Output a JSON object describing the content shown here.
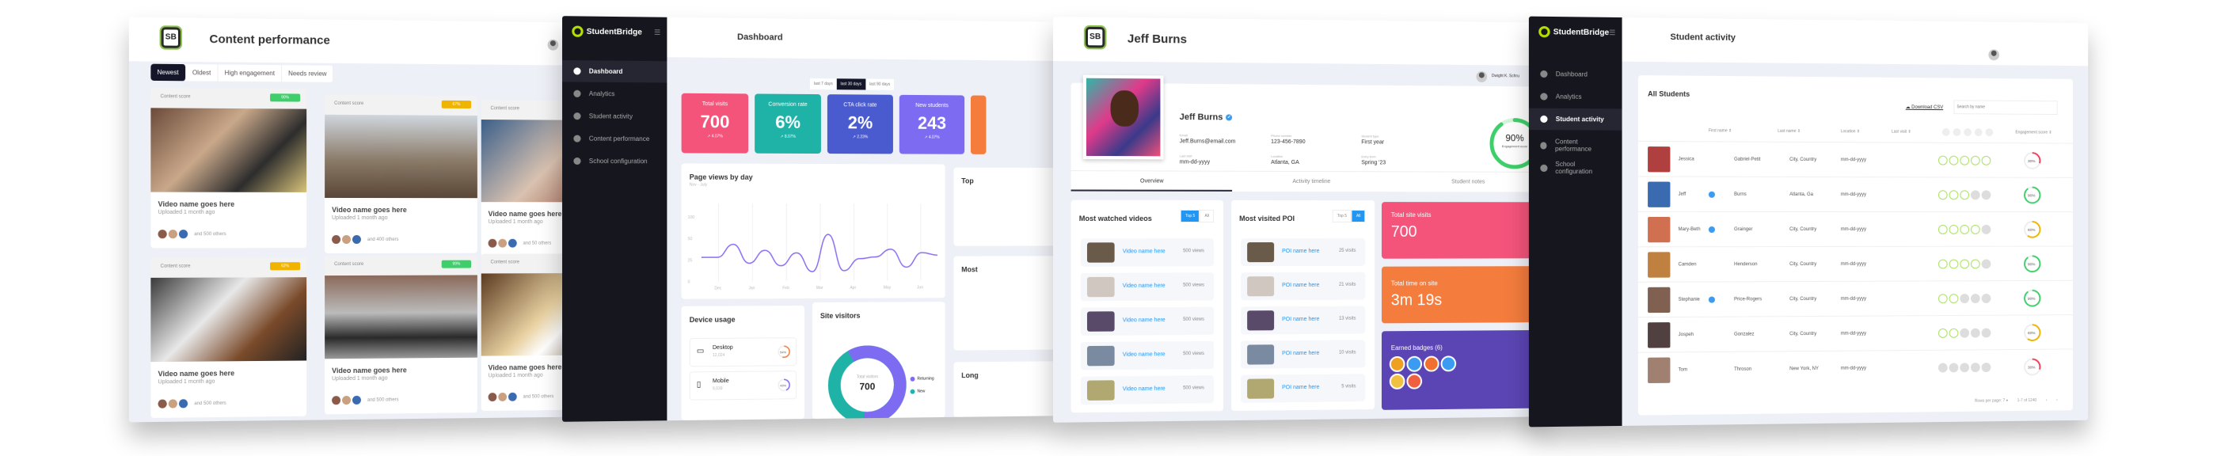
{
  "content_performance": {
    "title": "Content performance",
    "logo_text": "SB",
    "filters": [
      "Newest",
      "Oldest",
      "High engagement",
      "Needs review"
    ],
    "active_filter": "Newest",
    "cards": [
      {
        "score_label": "Content score",
        "score": "90%",
        "score_color": "#3ecf6a",
        "video_name": "Video name goes here",
        "uploaded": "Uploaded 1 month ago",
        "others": "and 500 others",
        "img": "linear-gradient(135deg,#6b4a3a,#c9a88a 40%,#2d2d2d 70%,#d8c37a)"
      },
      {
        "score_label": "Content score",
        "score": "67%",
        "score_color": "#f0b400",
        "video_name": "Video name goes here",
        "uploaded": "Uploaded 1 month ago",
        "others": "and 400 others",
        "img": "linear-gradient(180deg,#cfd6de,#8a7a68 55%,#5a4636)"
      },
      {
        "score_label": "Content score",
        "score": "",
        "score_color": "",
        "video_name": "Video name goes here",
        "uploaded": "Uploaded 1 month ago",
        "others": "and 50 others",
        "img": "linear-gradient(135deg,#3b5f8a,#d9c2b0 50%,#8a3a2a)"
      },
      {
        "score_label": "Content score",
        "score": "62%",
        "score_color": "#f0b400",
        "video_name": "Video name goes here",
        "uploaded": "Uploaded 1 month ago",
        "others": "and 500 others",
        "img": "linear-gradient(135deg,#3a3a3a,#e8e8e8 40%,#7a4a2a 70%,#222)"
      },
      {
        "score_label": "Content score",
        "score": "99%",
        "score_color": "#3ecf6a",
        "video_name": "Video name goes here",
        "uploaded": "Uploaded 1 month ago",
        "others": "and 500 others",
        "img": "linear-gradient(180deg,#8a6a5a,#bbb 45%,#2a2a2a 75%,#999)"
      },
      {
        "score_label": "Content score",
        "score": "",
        "score_color": "",
        "video_name": "Video name goes here",
        "uploaded": "Uploaded 1 month ago",
        "others": "and 500 others",
        "img": "linear-gradient(135deg,#5a3a20,#e8d0a0 45%,#fff 60%,#6a4a2a)"
      }
    ]
  },
  "dashboard": {
    "brand": "StudentBridge",
    "title": "Dashboard",
    "nav": [
      "Dashboard",
      "Analytics",
      "Student activity",
      "Content performance",
      "School configuration"
    ],
    "active_nav": "Dashboard",
    "ranges": [
      "last 7 days",
      "last 30 days",
      "last 90 days"
    ],
    "active_range": "last 30 days",
    "kpis": [
      {
        "label": "Total visits",
        "value": "700",
        "delta": "4.07%",
        "color": "#f4537a"
      },
      {
        "label": "Conversion rate",
        "value": "6%",
        "delta": "8.07%",
        "color": "#1fb3a8"
      },
      {
        "label": "CTA click rate",
        "value": "2%",
        "delta": "2.23%",
        "color": "#4a5bd0"
      },
      {
        "label": "New students",
        "value": "243",
        "delta": "4.07%",
        "color": "#7d6cf2"
      }
    ],
    "kpi_extra_color": "#f47c3c",
    "device_usage": {
      "title": "Device usage",
      "items": [
        {
          "label": "Desktop",
          "count": "12,024",
          "pct": "54%",
          "pct_value": 54,
          "color": "#f47c3c"
        },
        {
          "label": "Mobile",
          "count": "9,039",
          "pct": "43%",
          "pct_value": 43,
          "color": "#7d6cf2"
        }
      ]
    },
    "site_visitors": {
      "title": "Site visitors",
      "center_label": "Total visitors",
      "center_value": "700",
      "legend": [
        {
          "name": "Returning",
          "color": "#7d6cf2"
        },
        {
          "name": "New",
          "color": "#1fb3a8"
        }
      ]
    },
    "side_titles": [
      "Top",
      "Most",
      "Long"
    ]
  },
  "chart_data": {
    "type": "line",
    "title": "Page views by day",
    "subtitle": "Nov - July",
    "x_ticks": [
      "Dec",
      "Jan",
      "Feb",
      "Mar",
      "Apr",
      "May",
      "Jun"
    ],
    "y_ticks": [
      0,
      25,
      50,
      100
    ],
    "values": [
      28,
      28,
      43,
      21,
      36,
      18,
      33,
      11,
      59,
      12,
      26,
      28,
      37,
      16,
      33,
      30
    ],
    "color": "#8b6cf2",
    "grid": "vertical"
  },
  "student_profile": {
    "title": "Jeff Burns",
    "user": "Dwight K. Schru",
    "name": "Jeff Burns",
    "fields": [
      {
        "label": "Email",
        "value": "Jeff.Burns@email.com"
      },
      {
        "label": "Last visit",
        "value": "mm-dd-yyyy"
      },
      {
        "label": "Phone number",
        "value": "123-456-7890"
      },
      {
        "label": "Location",
        "value": "Atlanta, GA"
      },
      {
        "label": "Student type",
        "value": "First year"
      },
      {
        "label": "Entry term",
        "value": "Spring '23"
      }
    ],
    "engagement": {
      "value": "90%",
      "label": "Engagement score",
      "pct": 90
    },
    "tabs": [
      "Overview",
      "Activity timeline",
      "Student notes"
    ],
    "active_tab": "Overview",
    "videos": {
      "title": "Most watched videos",
      "toggle": [
        "Top 5",
        "All"
      ],
      "active": "Top 5",
      "items": [
        {
          "name": "Video name here",
          "views": "500 views"
        },
        {
          "name": "Video name here",
          "views": "500 views"
        },
        {
          "name": "Video name here",
          "views": "500 views"
        },
        {
          "name": "Video name here",
          "views": "500 views"
        },
        {
          "name": "Video name here",
          "views": "500 views"
        }
      ]
    },
    "poi": {
      "title": "Most visited POI",
      "toggle": [
        "Top 5",
        "All"
      ],
      "active": "All",
      "items": [
        {
          "name": "POI name here",
          "visits": "25 visits"
        },
        {
          "name": "POI name here",
          "visits": "21 visits"
        },
        {
          "name": "POI name here",
          "visits": "13 visits"
        },
        {
          "name": "POI name here",
          "visits": "10 visits"
        },
        {
          "name": "POI name here",
          "visits": "5 visits"
        }
      ]
    },
    "total_site_visits": {
      "label": "Total site visits",
      "value": "700"
    },
    "time_on_site": {
      "label": "Total time on site",
      "value": "3m 19s"
    },
    "badges": {
      "label": "Earned badges (6)",
      "count": 6
    }
  },
  "student_activity": {
    "brand": "StudentBridge",
    "title": "Student activity",
    "nav": [
      "Dashboard",
      "Analytics",
      "Student activity",
      "Content performance",
      "School configuration"
    ],
    "active_nav": "Student activity",
    "table_title": "All Students",
    "download": "Download CSV",
    "search_placeholder": "Search by name",
    "columns": [
      "First name",
      "Last name",
      "Location",
      "Last visit",
      "Engagement score"
    ],
    "rows": [
      {
        "first": "Jessica",
        "verified": false,
        "last": "Gabriel-Petit",
        "location": "City, Country",
        "visit": "mm-dd-yyyy",
        "badges": 5,
        "score": "30%",
        "pct": 30,
        "color": "#f0405a"
      },
      {
        "first": "Jeff",
        "verified": true,
        "last": "Burns",
        "location": "Atlanta, Ga",
        "visit": "mm-dd-yyyy",
        "badges": 3,
        "score": "90%",
        "pct": 90,
        "color": "#3ecf6a"
      },
      {
        "first": "Mary-Beth",
        "verified": true,
        "last": "Grainger",
        "location": "City, Country",
        "visit": "mm-dd-yyyy",
        "badges": 4,
        "score": "60%",
        "pct": 60,
        "color": "#f0b400"
      },
      {
        "first": "Camden",
        "verified": false,
        "last": "Henderson",
        "location": "City, Country",
        "visit": "mm-dd-yyyy",
        "badges": 4,
        "score": "90%",
        "pct": 90,
        "color": "#3ecf6a"
      },
      {
        "first": "Stephanie",
        "verified": true,
        "last": "Price-Rogers",
        "location": "City, Country",
        "visit": "mm-dd-yyyy",
        "badges": 2,
        "score": "90%",
        "pct": 90,
        "color": "#3ecf6a"
      },
      {
        "first": "Jospeh",
        "verified": false,
        "last": "Gonzalez",
        "location": "City, Country",
        "visit": "mm-dd-yyyy",
        "badges": 2,
        "score": "60%",
        "pct": 60,
        "color": "#f0b400"
      },
      {
        "first": "Tom",
        "verified": false,
        "last": "Throson",
        "location": "New York, NY",
        "visit": "mm-dd-yyyy",
        "badges": 0,
        "score": "30%",
        "pct": 30,
        "color": "#f0405a"
      }
    ],
    "rows_per_page_label": "Rows per page:",
    "rows_per_page": "7",
    "pagination": "1-7 of 1240"
  }
}
